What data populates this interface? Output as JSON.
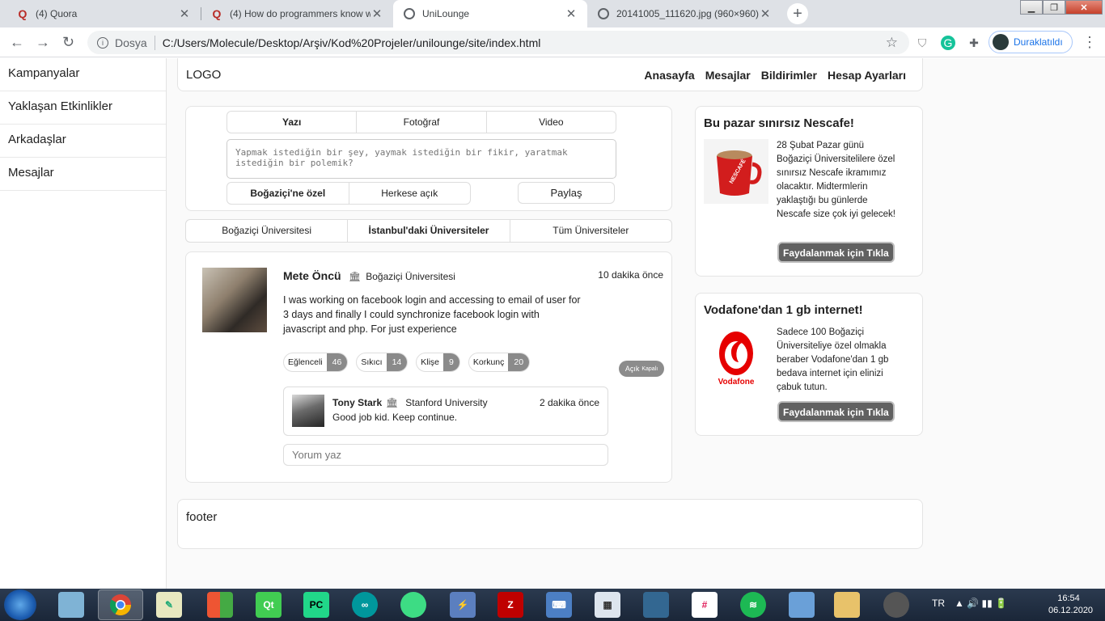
{
  "browser": {
    "tabs": [
      {
        "title": "(4) Quora",
        "icon": "quora-icon"
      },
      {
        "title": "(4) How do programmers know wh",
        "icon": "quora-icon"
      },
      {
        "title": "UniLounge",
        "icon": "globe-icon",
        "active": true
      },
      {
        "title": "20141005_111620.jpg (960×960)",
        "icon": "globe-icon"
      }
    ],
    "scheme_label": "Dosya",
    "url": "C:/Users/Molecule/Desktop/Arşiv/Kod%20Projeler/unilounge/site/index.html",
    "profile_label": "Duraklatıldı"
  },
  "sidebar": {
    "items": [
      {
        "label": "Kampanyalar"
      },
      {
        "label": "Yaklaşan Etkinlikler"
      },
      {
        "label": "Arkadaşlar"
      },
      {
        "label": "Mesajlar"
      }
    ]
  },
  "header": {
    "logo": "LOGO",
    "nav": [
      "Anasayfa",
      "Mesajlar",
      "Bildirimler",
      "Hesap Ayarları"
    ]
  },
  "composer": {
    "types": [
      "Yazı",
      "Fotoğraf",
      "Video"
    ],
    "placeholder": "Yapmak istediğin bir şey, yaymak istediğin bir fikir, yaratmak istediğin bir polemik?",
    "audience": [
      "Boğaziçi'ne özel",
      "Herkese açık"
    ],
    "share_label": "Paylaş"
  },
  "scope_tabs": [
    "Boğaziçi Üniversitesi",
    "İstanbul'daki Üniversiteler",
    "Tüm Üniversiteler"
  ],
  "post": {
    "author": "Mete Öncü",
    "university": "Boğaziçi Üniversitesi",
    "time": "10 dakika önce",
    "text": "I was working on facebook login and accessing to email of user for 3 days and finally I could synchronize facebook login with javascript and php. For just experience",
    "reactions": [
      {
        "label": "Eğlenceli",
        "count": "46"
      },
      {
        "label": "Sıkıcı",
        "count": "14"
      },
      {
        "label": "Klişe",
        "count": "9"
      },
      {
        "label": "Korkunç",
        "count": "20"
      }
    ],
    "toggle_on": "Açık",
    "toggle_off": "Kapalı",
    "comment": {
      "author": "Tony Stark",
      "university": "Stanford University",
      "time": "2 dakika önce",
      "text": "Good job kid. Keep continue."
    },
    "comment_placeholder": "Yorum yaz"
  },
  "ads": [
    {
      "title": "Bu pazar sınırsız Nescafe!",
      "text": "28 Şubat Pazar günü Boğaziçi Üniversitelilere özel sınırsız Nescafe ikramımız olacaktır. Midtermlerin yaklaştığı bu günlerde Nescafe size çok iyi gelecek!",
      "cta": "Faydalanmak için Tıkla",
      "brand": "NESCAFÉ"
    },
    {
      "title": "Vodafone'dan 1 gb internet!",
      "text": "Sadece 100 Boğaziçi Üniversiteliye özel olmakla beraber Vodafone'dan 1 gb bedava internet için elinizi çabuk tutun.",
      "cta": "Faydalanmak için Tıkla",
      "brand": "Vodafone"
    }
  ],
  "footer": {
    "text": "footer"
  },
  "taskbar": {
    "lang": "TR",
    "time": "16:54",
    "date": "06.12.2020"
  }
}
